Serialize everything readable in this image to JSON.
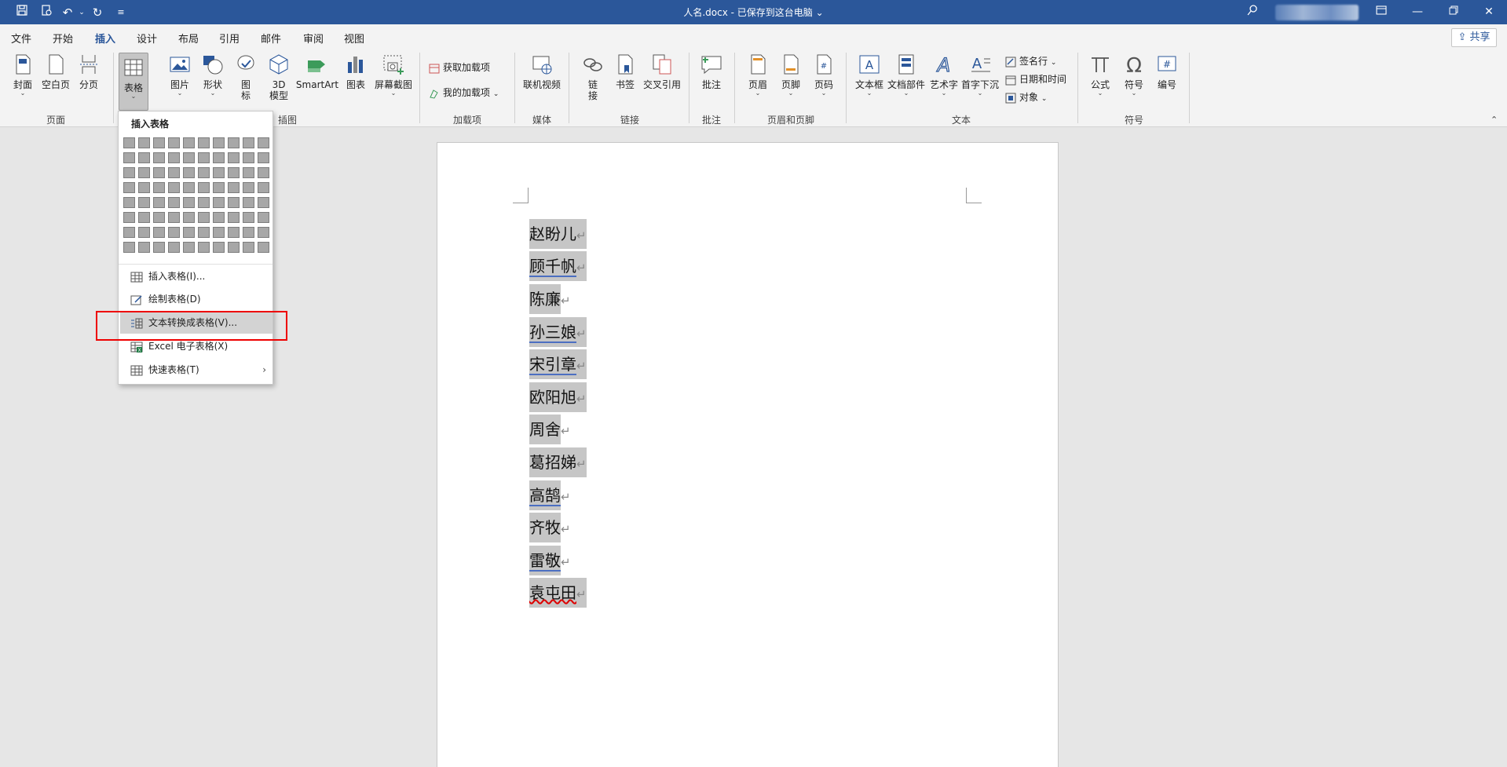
{
  "titlebar": {
    "title": "人名.docx - 已保存到这台电脑",
    "title_caret": "⌄",
    "quick_access": [
      "save-icon",
      "touch-mode-icon",
      "undo-icon",
      "redo-icon",
      "customize-icon"
    ]
  },
  "menu_tabs": [
    "文件",
    "开始",
    "插入",
    "设计",
    "布局",
    "引用",
    "邮件",
    "审阅",
    "视图"
  ],
  "active_tab": "插入",
  "share_label": "共享",
  "ribbon": {
    "page_group": {
      "label": "页面",
      "buttons": [
        "封面",
        "空白页",
        "分页"
      ]
    },
    "table_group": {
      "buttons": [
        "表格"
      ]
    },
    "illustration_group": {
      "label": "插图",
      "buttons": [
        "图片",
        "形状",
        "图标",
        "3D 模型",
        "SmartArt",
        "图表",
        "屏幕截图"
      ]
    },
    "addins_group": {
      "label": "加载项",
      "buttons": [
        "获取加载项",
        "我的加载项"
      ]
    },
    "media_group": {
      "label": "媒体",
      "buttons": [
        "联机视频"
      ]
    },
    "links_group": {
      "label": "链接",
      "buttons": [
        "链接",
        "书签",
        "交叉引用"
      ]
    },
    "comment_group": {
      "label": "批注",
      "buttons": [
        "批注"
      ]
    },
    "header_footer_group": {
      "label": "页眉和页脚",
      "buttons": [
        "页眉",
        "页脚",
        "页码"
      ]
    },
    "text_group": {
      "label": "文本",
      "buttons": [
        "文本框",
        "文档部件",
        "艺术字",
        "首字下沉"
      ],
      "small_buttons": [
        "签名行",
        "日期和时间",
        "对象"
      ]
    },
    "symbol_group": {
      "label": "符号",
      "buttons": [
        "公式",
        "符号",
        "编号"
      ]
    }
  },
  "dropdown": {
    "title": "插入表格",
    "items": [
      {
        "label": "插入表格(I)..."
      },
      {
        "label": "绘制表格(D)"
      },
      {
        "label": "文本转换成表格(V)..."
      },
      {
        "label": "Excel 电子表格(X)"
      },
      {
        "label": "快速表格(T)"
      }
    ]
  },
  "document": {
    "names": [
      "赵盼儿",
      "顾千帆",
      "陈廉",
      "孙三娘",
      "宋引章",
      "欧阳旭",
      "周舍",
      "葛招娣",
      "高鹄",
      "齐牧",
      "雷敬",
      "袁屯田"
    ],
    "paragraph_mark": "↵"
  },
  "colors": {
    "titlebar": "#2b579a",
    "highlight_box": "#e00000",
    "selection": "#c6c6c6"
  }
}
